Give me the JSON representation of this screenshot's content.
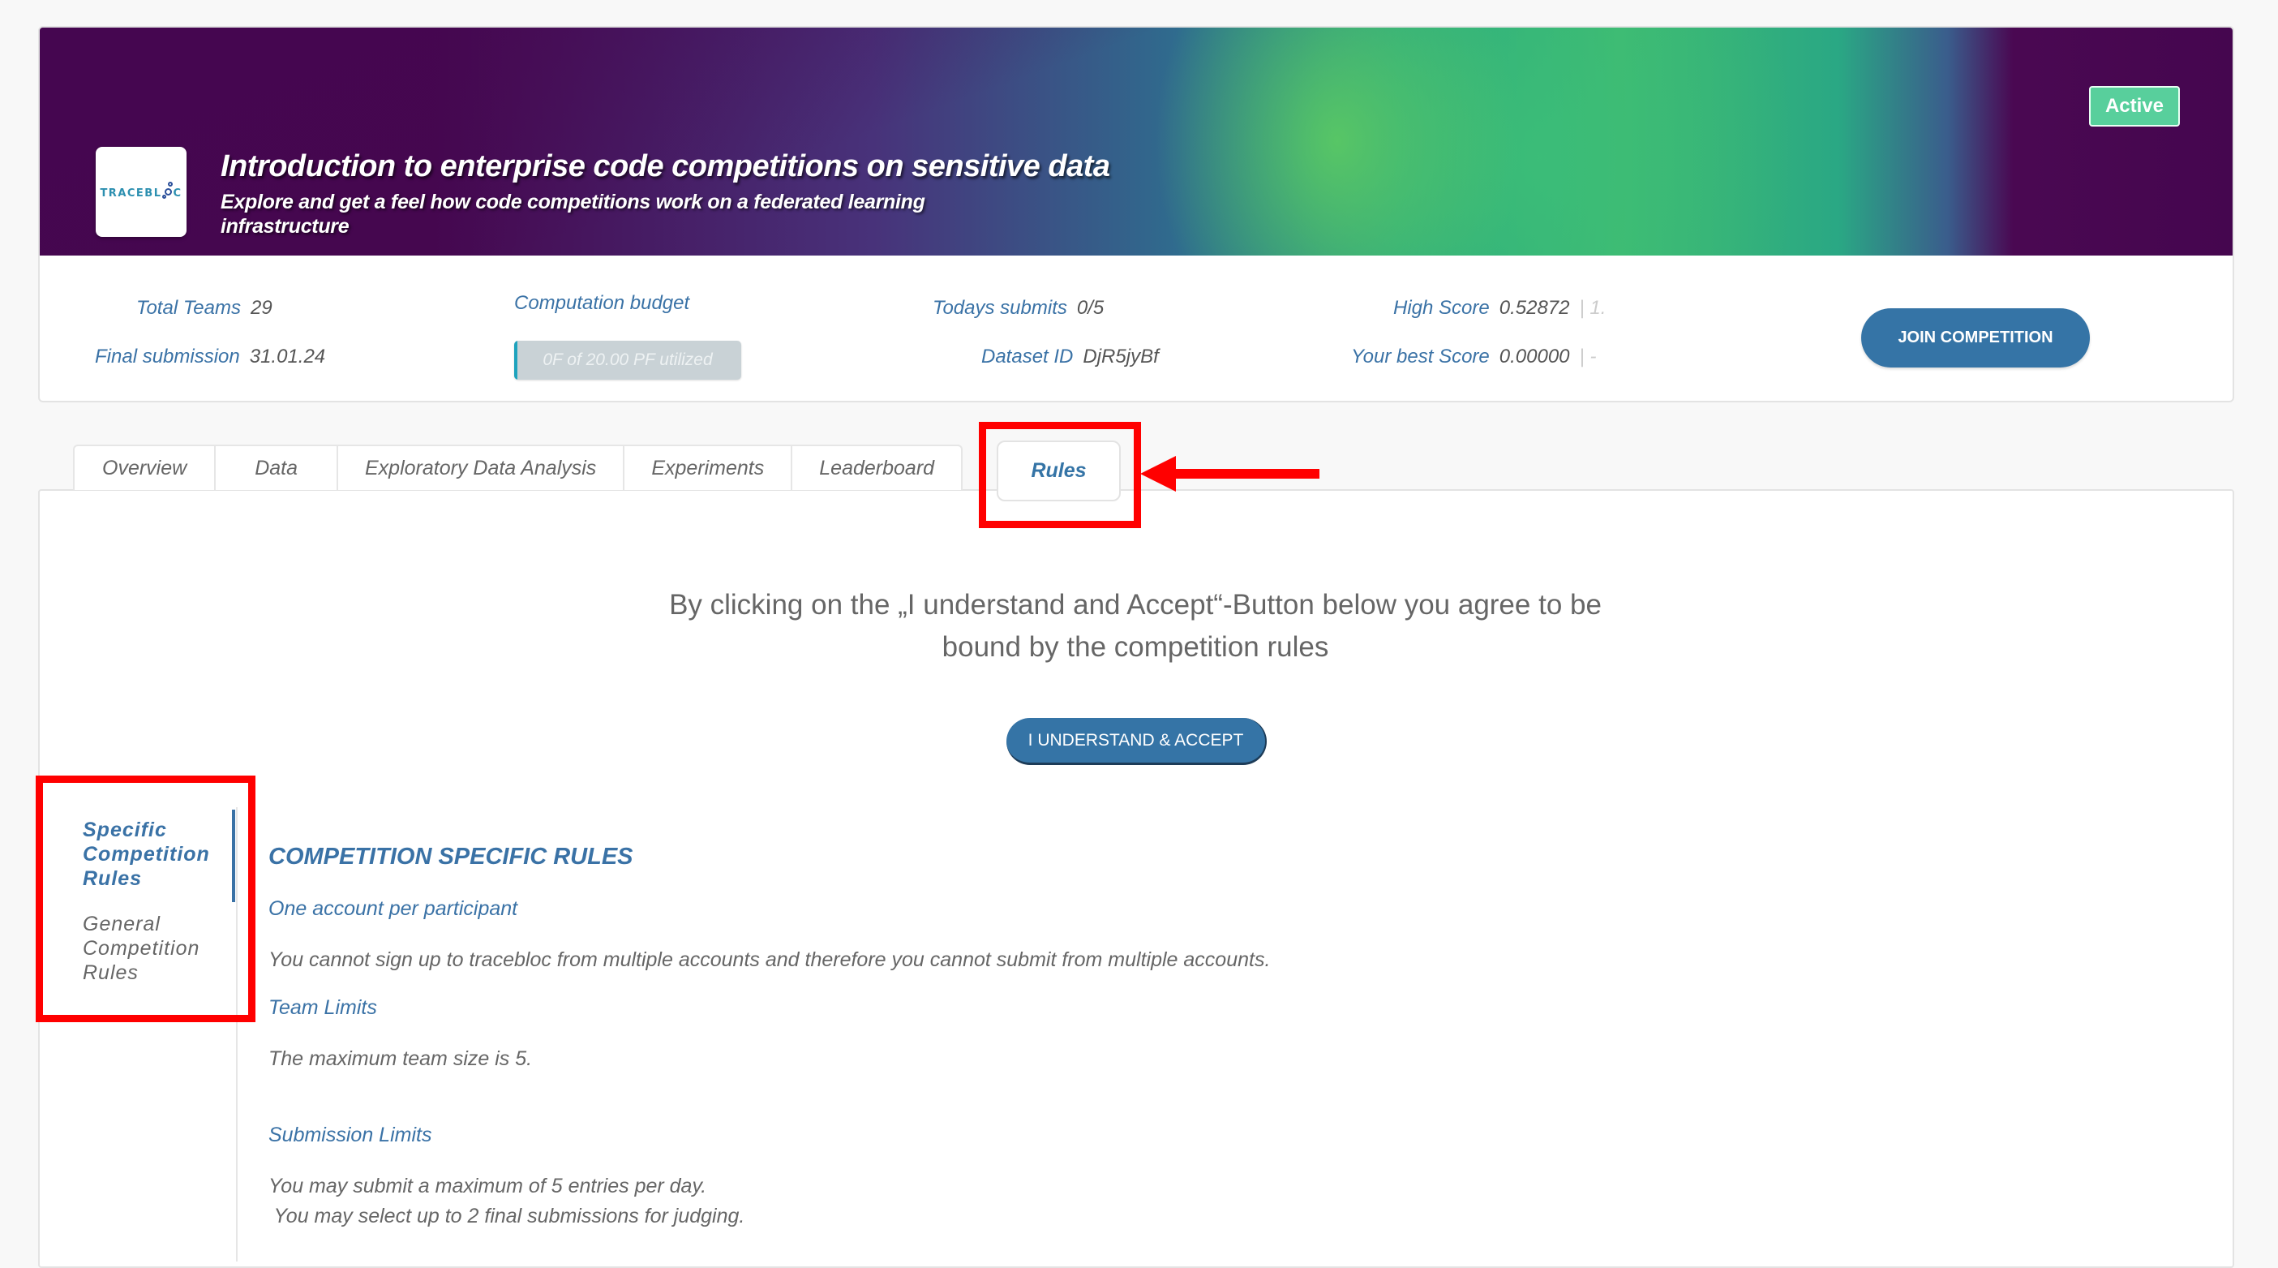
{
  "header": {
    "title": "Introduction to enterprise code competitions on sensitive data",
    "subtitle": "Explore and get a feel how code competitions work on a federated learning infrastructure",
    "status_badge": "Active",
    "logo": {
      "text": "TRACEBL",
      "text_end": "C"
    },
    "colors": {
      "badge": "#58cf9c",
      "primary": "#3574a6",
      "banner_dark": "#45064f"
    }
  },
  "stats": {
    "total_teams": {
      "label": "Total Teams",
      "value": "29"
    },
    "final_submission": {
      "label": "Final submission",
      "value": "31.01.24"
    },
    "computation_budget": {
      "label": "Computation budget",
      "progress_text": "0F of 20.00 PF utilized",
      "utilized_fraction": 0.0
    },
    "todays_submits": {
      "label": "Todays submits",
      "value": "0/5"
    },
    "dataset_id": {
      "label": "Dataset ID",
      "value": "DjR5jyBf"
    },
    "high_score": {
      "label": "High Score",
      "value": "0.52872",
      "rank": "1."
    },
    "your_best_score": {
      "label": "Your best Score",
      "value": "0.00000",
      "rank": "-"
    },
    "join_button": "JOIN COMPETITION"
  },
  "tabs": [
    {
      "label": "Overview"
    },
    {
      "label": "Data"
    },
    {
      "label": "Exploratory Data Analysis"
    },
    {
      "label": "Experiments"
    },
    {
      "label": "Leaderboard"
    },
    {
      "label": "Rules",
      "active": true
    }
  ],
  "rules_page": {
    "consent_text": "By clicking on the „I understand and Accept“-Button below you agree to be bound by the competition rules",
    "accept_button": "I UNDERSTAND & ACCEPT",
    "sidebar": [
      {
        "label": "Specific Competition Rules",
        "active": true
      },
      {
        "label": "General Competition Rules",
        "active": false
      }
    ],
    "heading": "COMPETITION SPECIFIC RULES",
    "sections": [
      {
        "title": "One account per participant",
        "text": "You cannot sign up to tracebloc from multiple accounts and therefore you cannot submit from multiple accounts."
      },
      {
        "title": "Team Limits",
        "text": "The maximum team size is 5."
      },
      {
        "title": "Submission Limits",
        "text": "You may submit a maximum of 5 entries per day.\n You may select up to 2 final submissions for judging."
      }
    ]
  }
}
